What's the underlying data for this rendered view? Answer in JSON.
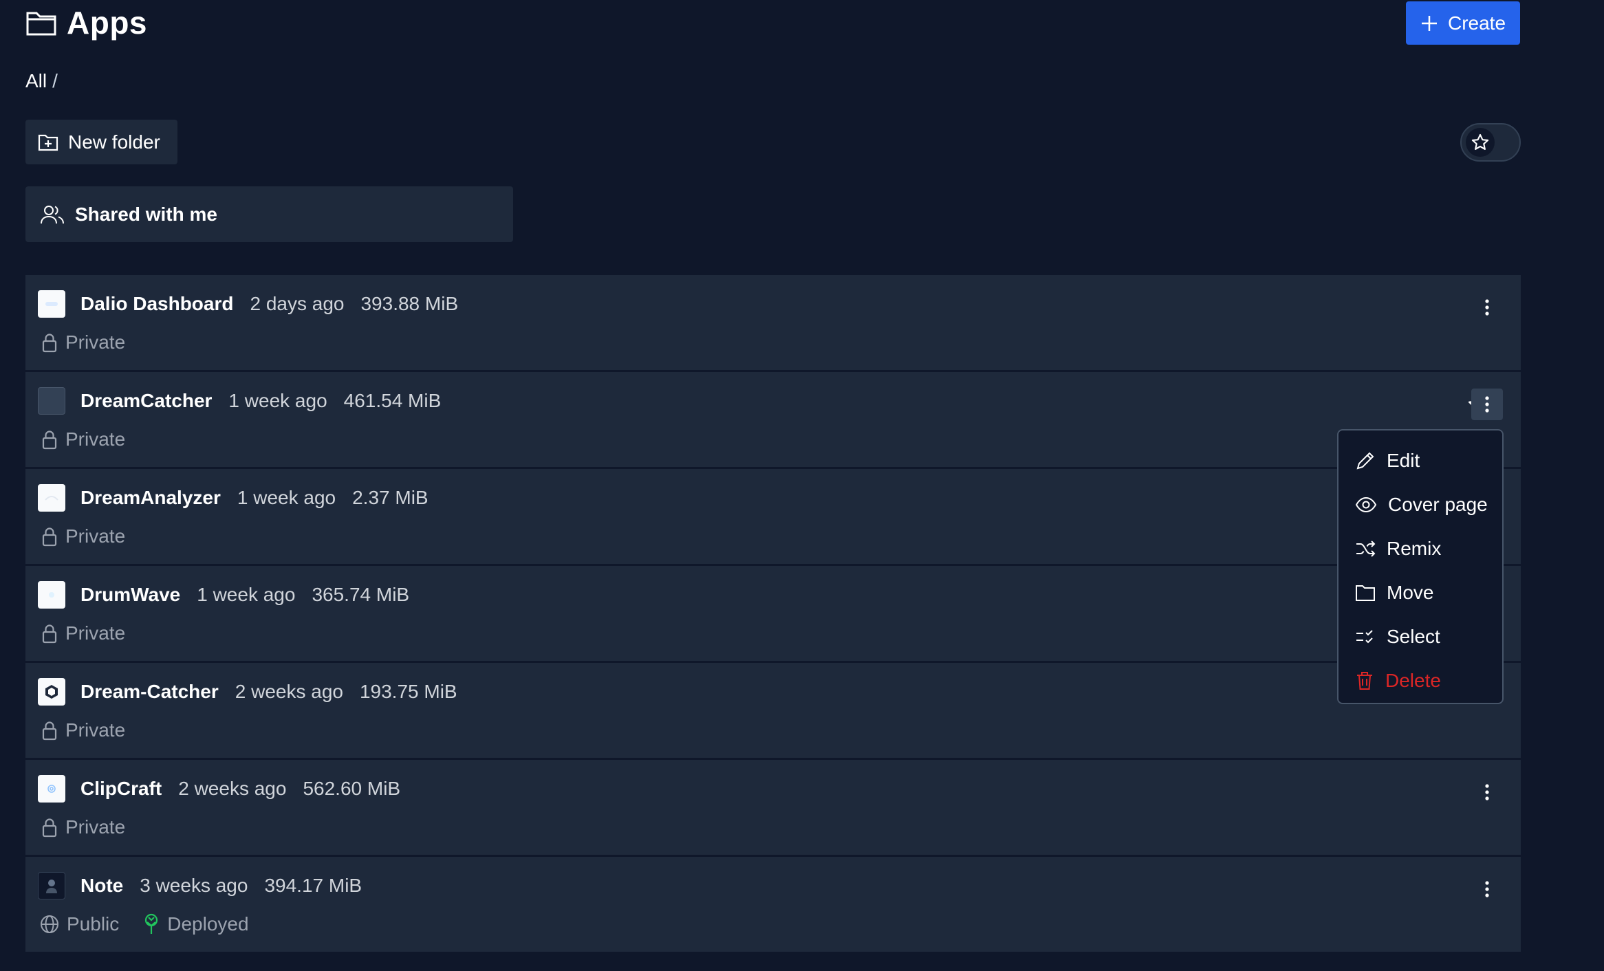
{
  "header": {
    "title": "Apps",
    "create_label": "Create"
  },
  "breadcrumb": {
    "root": "All",
    "separator": "/"
  },
  "toolbar": {
    "new_folder_label": "New folder"
  },
  "shared": {
    "label": "Shared with me"
  },
  "apps": [
    {
      "name": "Dalio Dashboard",
      "updated": "2 days ago",
      "size": "393.88 MiB",
      "visibility": "Private",
      "deployed": ""
    },
    {
      "name": "DreamCatcher",
      "updated": "1 week ago",
      "size": "461.54 MiB",
      "visibility": "Private",
      "deployed": ""
    },
    {
      "name": "DreamAnalyzer",
      "updated": "1 week ago",
      "size": "2.37 MiB",
      "visibility": "Private",
      "deployed": ""
    },
    {
      "name": "DrumWave",
      "updated": "1 week ago",
      "size": "365.74 MiB",
      "visibility": "Private",
      "deployed": ""
    },
    {
      "name": "Dream-Catcher",
      "updated": "2 weeks ago",
      "size": "193.75 MiB",
      "visibility": "Private",
      "deployed": ""
    },
    {
      "name": "ClipCraft",
      "updated": "2 weeks ago",
      "size": "562.60 MiB",
      "visibility": "Private",
      "deployed": ""
    },
    {
      "name": "Note",
      "updated": "3 weeks ago",
      "size": "394.17 MiB",
      "visibility": "Public",
      "deployed": "Deployed"
    }
  ],
  "context_menu": {
    "edit": "Edit",
    "cover_page": "Cover page",
    "remix": "Remix",
    "move": "Move",
    "select": "Select",
    "delete": "Delete"
  },
  "colors": {
    "background": "#0f172a",
    "row_background": "#1e293b",
    "accent": "#2563eb",
    "danger": "#dc2626",
    "deployed": "#22c55e",
    "muted_text": "#9ca3af"
  }
}
